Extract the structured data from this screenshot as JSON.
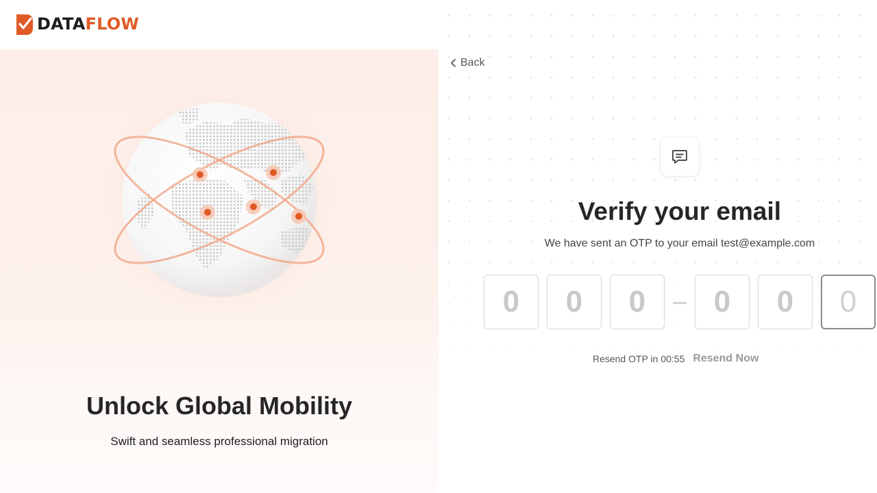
{
  "brand": {
    "part1": "DATA",
    "part2": "FLOW",
    "accent": "#e05a26"
  },
  "hero": {
    "title": "Unlock Global Mobility",
    "subtitle": "Swift and seamless professional migration",
    "illustration": "globe-with-orbits-and-location-pins"
  },
  "nav": {
    "back_label": "Back",
    "back_icon": "chevron-left-icon"
  },
  "verify": {
    "icon": "chat-message-icon",
    "title": "Verify your email",
    "subtitle": "We have sent an OTP to your email test@example.com",
    "otp_digits": [
      "0",
      "0",
      "0",
      "0",
      "0",
      "0"
    ],
    "resend_timer": "Resend OTP in 00:55",
    "resend_label": "Resend Now"
  }
}
